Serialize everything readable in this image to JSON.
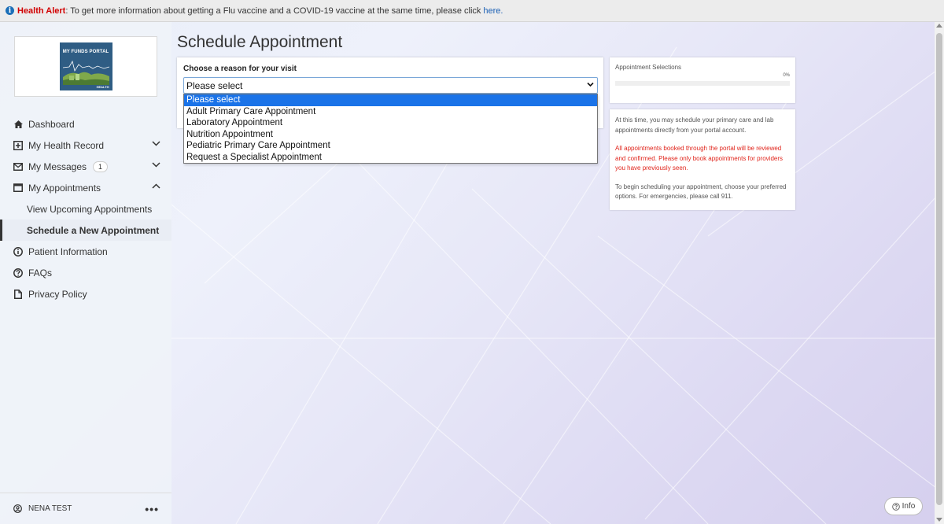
{
  "alert": {
    "title": "Health Alert",
    "message": ": To get more information about getting a Flu vaccine and a COVID-19 vaccine at the same time, please click",
    "link_text": "here."
  },
  "logo": {
    "title": "MY FUNDS PORTAL",
    "subtitle": "HEALTH"
  },
  "sidebar": {
    "items": [
      {
        "label": "Dashboard",
        "icon": "home-icon"
      },
      {
        "label": "My Health Record",
        "icon": "plus-square-icon",
        "expandable": true
      },
      {
        "label": "My Messages",
        "icon": "envelope-icon",
        "badge": "1",
        "expandable": true
      },
      {
        "label": "My Appointments",
        "icon": "calendar-icon",
        "expanded": true
      },
      {
        "label": "Patient Information",
        "icon": "info-circle-icon"
      },
      {
        "label": "FAQs",
        "icon": "question-circle-icon"
      },
      {
        "label": "Privacy Policy",
        "icon": "document-icon"
      }
    ],
    "sub_items": [
      {
        "label": "View Upcoming Appointments"
      },
      {
        "label": "Schedule a New Appointment",
        "active": true
      }
    ],
    "user_name": "NENA TEST",
    "more_label": "•••"
  },
  "main": {
    "title": "Schedule Appointment",
    "reason_label": "Choose a reason for your visit",
    "select_value": "Please select",
    "options": [
      "Please select",
      "Adult Primary Care Appointment",
      "Laboratory Appointment",
      "Nutrition Appointment",
      "Pediatric Primary Care Appointment",
      "Request a Specialist Appointment"
    ]
  },
  "progress": {
    "title": "Appointment Selections",
    "percent_label": "0%",
    "value": 0
  },
  "info_card": {
    "p1": "At this time, you may schedule your primary care and lab appointments directly from your portal account.",
    "p2": "All appointments booked through the portal will be reviewed and confirmed. Please only book appointments for providers you have previously seen.",
    "p3": "To begin scheduling your appointment, choose your preferred options. For emergencies, please call 911."
  },
  "info_button": {
    "label": "Info"
  },
  "colors": {
    "alert_red": "#d10000",
    "link_blue": "#1a5fb4",
    "accent_blue": "#1a73e8",
    "warn_red": "#e0241b"
  }
}
